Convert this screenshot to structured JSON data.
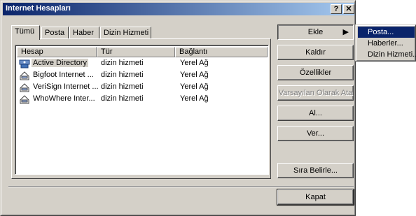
{
  "window": {
    "title": "Internet Hesapları"
  },
  "title_buttons": {
    "help": "?",
    "close": "✕"
  },
  "tabs": [
    "Tümü",
    "Posta",
    "Haber",
    "Dizin Hizmeti"
  ],
  "list": {
    "columns": [
      "Hesap",
      "Tür",
      "Bağlantı"
    ],
    "rows": [
      {
        "name": "Active Directory",
        "type": "dizin hizmeti",
        "connection": "Yerel Ağ",
        "icon": "directory-service-icon"
      },
      {
        "name": "Bigfoot Internet ...",
        "type": "dizin hizmeti",
        "connection": "Yerel Ağ",
        "icon": "directory-service-icon"
      },
      {
        "name": "VeriSign Internet ...",
        "type": "dizin hizmeti",
        "connection": "Yerel Ağ",
        "icon": "directory-service-icon"
      },
      {
        "name": "WhoWhere Inter...",
        "type": "dizin hizmeti",
        "connection": "Yerel Ağ",
        "icon": "directory-service-icon"
      }
    ]
  },
  "buttons": {
    "add": "Ekle",
    "remove": "Kaldır",
    "properties": "Özellikler",
    "set_default": "Varsayılan Olarak Ata",
    "import": "Al...",
    "export": "Ver...",
    "set_order": "Sıra Belirle...",
    "close": "Kapat"
  },
  "add_menu": [
    "Posta...",
    "Haberler...",
    "Dizin Hizmeti..."
  ],
  "colors": {
    "titlebar_start": "#0a246a",
    "titlebar_end": "#a6caf0",
    "face": "#d4d0c8",
    "highlight": "#0a246a"
  }
}
